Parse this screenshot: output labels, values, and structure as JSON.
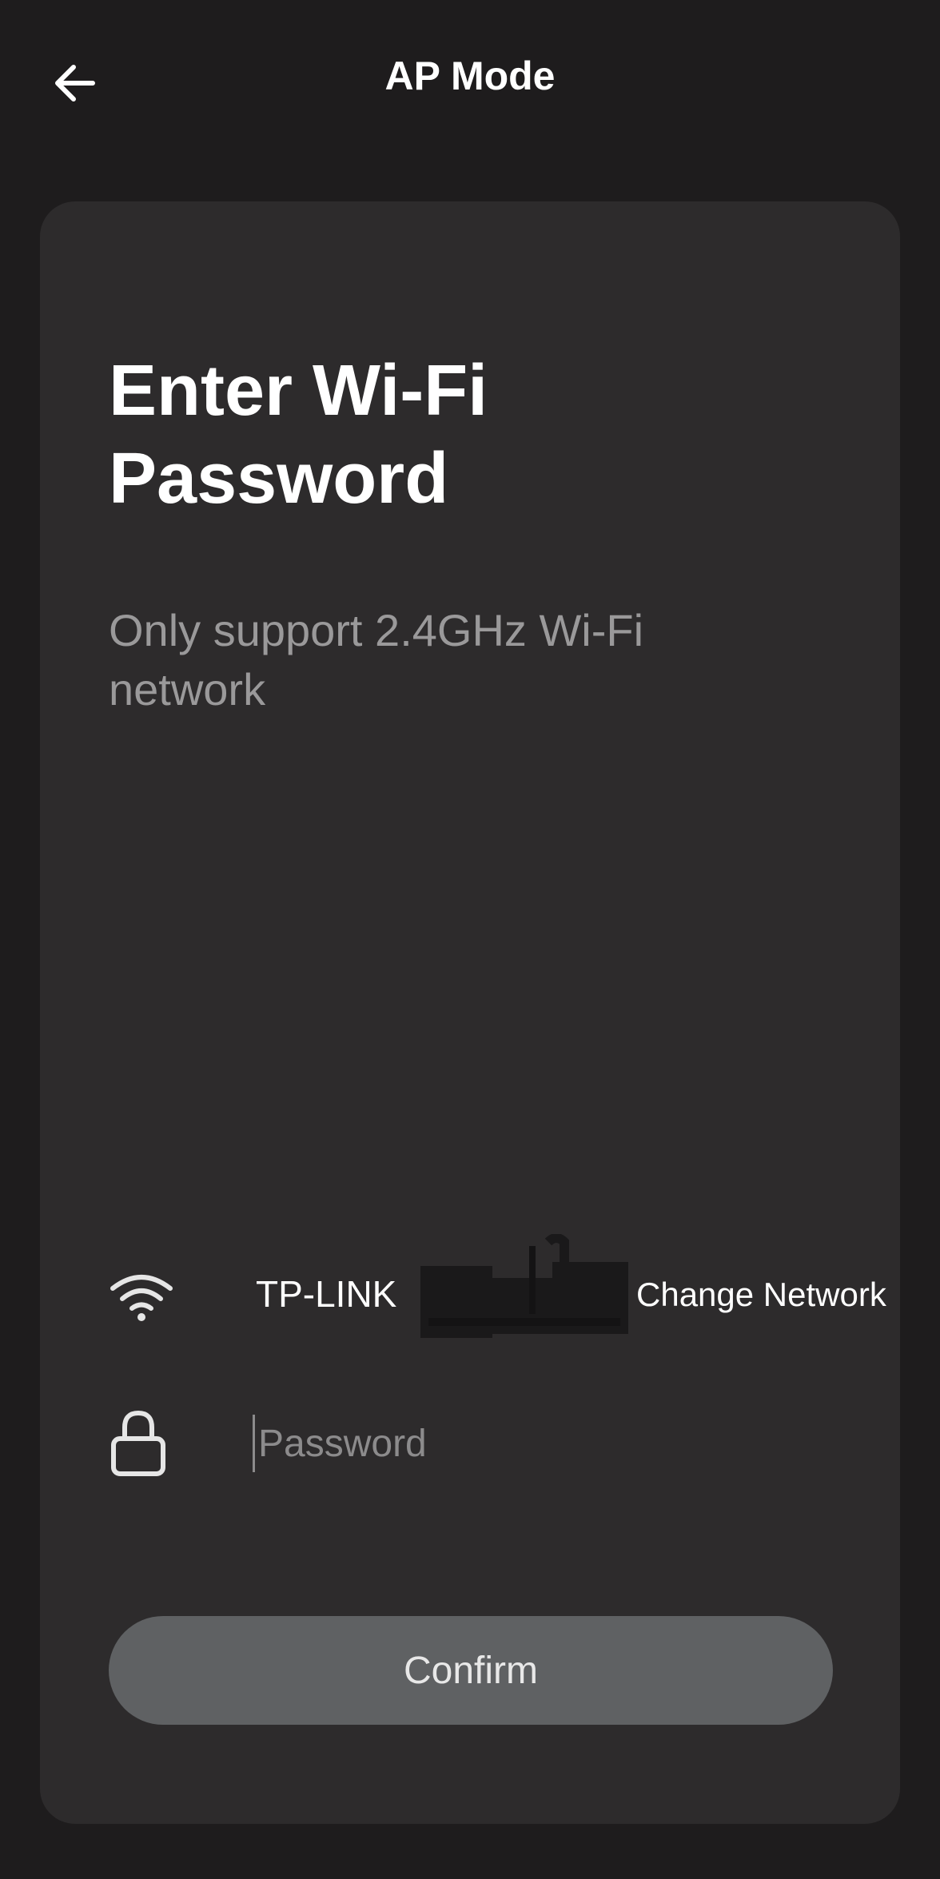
{
  "header": {
    "back_icon": "arrow-left-icon",
    "title": "AP Mode"
  },
  "card": {
    "title": "Enter Wi-Fi\nPassword",
    "subtitle": "Only support 2.4GHz Wi-Fi\nnetwork"
  },
  "network": {
    "icon": "wifi-icon",
    "name": "TP-LINK",
    "change_label": "Change Network"
  },
  "password": {
    "icon": "lock-icon",
    "value": "",
    "placeholder": "Password"
  },
  "confirm": {
    "label": "Confirm"
  },
  "colors": {
    "background": "#1e1c1d",
    "card": "#2d2b2c",
    "button": "#5f6163",
    "subtitle": "#9a999a"
  }
}
